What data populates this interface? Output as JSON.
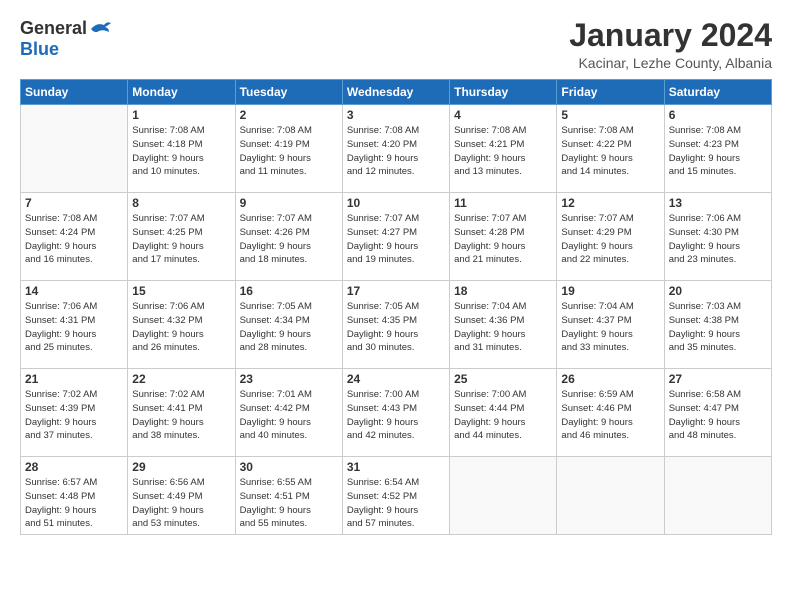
{
  "header": {
    "logo_general": "General",
    "logo_blue": "Blue",
    "month_title": "January 2024",
    "location": "Kacinar, Lezhe County, Albania"
  },
  "days_of_week": [
    "Sunday",
    "Monday",
    "Tuesday",
    "Wednesday",
    "Thursday",
    "Friday",
    "Saturday"
  ],
  "weeks": [
    [
      {
        "day": "",
        "info": ""
      },
      {
        "day": "1",
        "info": "Sunrise: 7:08 AM\nSunset: 4:18 PM\nDaylight: 9 hours\nand 10 minutes."
      },
      {
        "day": "2",
        "info": "Sunrise: 7:08 AM\nSunset: 4:19 PM\nDaylight: 9 hours\nand 11 minutes."
      },
      {
        "day": "3",
        "info": "Sunrise: 7:08 AM\nSunset: 4:20 PM\nDaylight: 9 hours\nand 12 minutes."
      },
      {
        "day": "4",
        "info": "Sunrise: 7:08 AM\nSunset: 4:21 PM\nDaylight: 9 hours\nand 13 minutes."
      },
      {
        "day": "5",
        "info": "Sunrise: 7:08 AM\nSunset: 4:22 PM\nDaylight: 9 hours\nand 14 minutes."
      },
      {
        "day": "6",
        "info": "Sunrise: 7:08 AM\nSunset: 4:23 PM\nDaylight: 9 hours\nand 15 minutes."
      }
    ],
    [
      {
        "day": "7",
        "info": "Sunrise: 7:08 AM\nSunset: 4:24 PM\nDaylight: 9 hours\nand 16 minutes."
      },
      {
        "day": "8",
        "info": "Sunrise: 7:07 AM\nSunset: 4:25 PM\nDaylight: 9 hours\nand 17 minutes."
      },
      {
        "day": "9",
        "info": "Sunrise: 7:07 AM\nSunset: 4:26 PM\nDaylight: 9 hours\nand 18 minutes."
      },
      {
        "day": "10",
        "info": "Sunrise: 7:07 AM\nSunset: 4:27 PM\nDaylight: 9 hours\nand 19 minutes."
      },
      {
        "day": "11",
        "info": "Sunrise: 7:07 AM\nSunset: 4:28 PM\nDaylight: 9 hours\nand 21 minutes."
      },
      {
        "day": "12",
        "info": "Sunrise: 7:07 AM\nSunset: 4:29 PM\nDaylight: 9 hours\nand 22 minutes."
      },
      {
        "day": "13",
        "info": "Sunrise: 7:06 AM\nSunset: 4:30 PM\nDaylight: 9 hours\nand 23 minutes."
      }
    ],
    [
      {
        "day": "14",
        "info": "Sunrise: 7:06 AM\nSunset: 4:31 PM\nDaylight: 9 hours\nand 25 minutes."
      },
      {
        "day": "15",
        "info": "Sunrise: 7:06 AM\nSunset: 4:32 PM\nDaylight: 9 hours\nand 26 minutes."
      },
      {
        "day": "16",
        "info": "Sunrise: 7:05 AM\nSunset: 4:34 PM\nDaylight: 9 hours\nand 28 minutes."
      },
      {
        "day": "17",
        "info": "Sunrise: 7:05 AM\nSunset: 4:35 PM\nDaylight: 9 hours\nand 30 minutes."
      },
      {
        "day": "18",
        "info": "Sunrise: 7:04 AM\nSunset: 4:36 PM\nDaylight: 9 hours\nand 31 minutes."
      },
      {
        "day": "19",
        "info": "Sunrise: 7:04 AM\nSunset: 4:37 PM\nDaylight: 9 hours\nand 33 minutes."
      },
      {
        "day": "20",
        "info": "Sunrise: 7:03 AM\nSunset: 4:38 PM\nDaylight: 9 hours\nand 35 minutes."
      }
    ],
    [
      {
        "day": "21",
        "info": "Sunrise: 7:02 AM\nSunset: 4:39 PM\nDaylight: 9 hours\nand 37 minutes."
      },
      {
        "day": "22",
        "info": "Sunrise: 7:02 AM\nSunset: 4:41 PM\nDaylight: 9 hours\nand 38 minutes."
      },
      {
        "day": "23",
        "info": "Sunrise: 7:01 AM\nSunset: 4:42 PM\nDaylight: 9 hours\nand 40 minutes."
      },
      {
        "day": "24",
        "info": "Sunrise: 7:00 AM\nSunset: 4:43 PM\nDaylight: 9 hours\nand 42 minutes."
      },
      {
        "day": "25",
        "info": "Sunrise: 7:00 AM\nSunset: 4:44 PM\nDaylight: 9 hours\nand 44 minutes."
      },
      {
        "day": "26",
        "info": "Sunrise: 6:59 AM\nSunset: 4:46 PM\nDaylight: 9 hours\nand 46 minutes."
      },
      {
        "day": "27",
        "info": "Sunrise: 6:58 AM\nSunset: 4:47 PM\nDaylight: 9 hours\nand 48 minutes."
      }
    ],
    [
      {
        "day": "28",
        "info": "Sunrise: 6:57 AM\nSunset: 4:48 PM\nDaylight: 9 hours\nand 51 minutes."
      },
      {
        "day": "29",
        "info": "Sunrise: 6:56 AM\nSunset: 4:49 PM\nDaylight: 9 hours\nand 53 minutes."
      },
      {
        "day": "30",
        "info": "Sunrise: 6:55 AM\nSunset: 4:51 PM\nDaylight: 9 hours\nand 55 minutes."
      },
      {
        "day": "31",
        "info": "Sunrise: 6:54 AM\nSunset: 4:52 PM\nDaylight: 9 hours\nand 57 minutes."
      },
      {
        "day": "",
        "info": ""
      },
      {
        "day": "",
        "info": ""
      },
      {
        "day": "",
        "info": ""
      }
    ]
  ]
}
